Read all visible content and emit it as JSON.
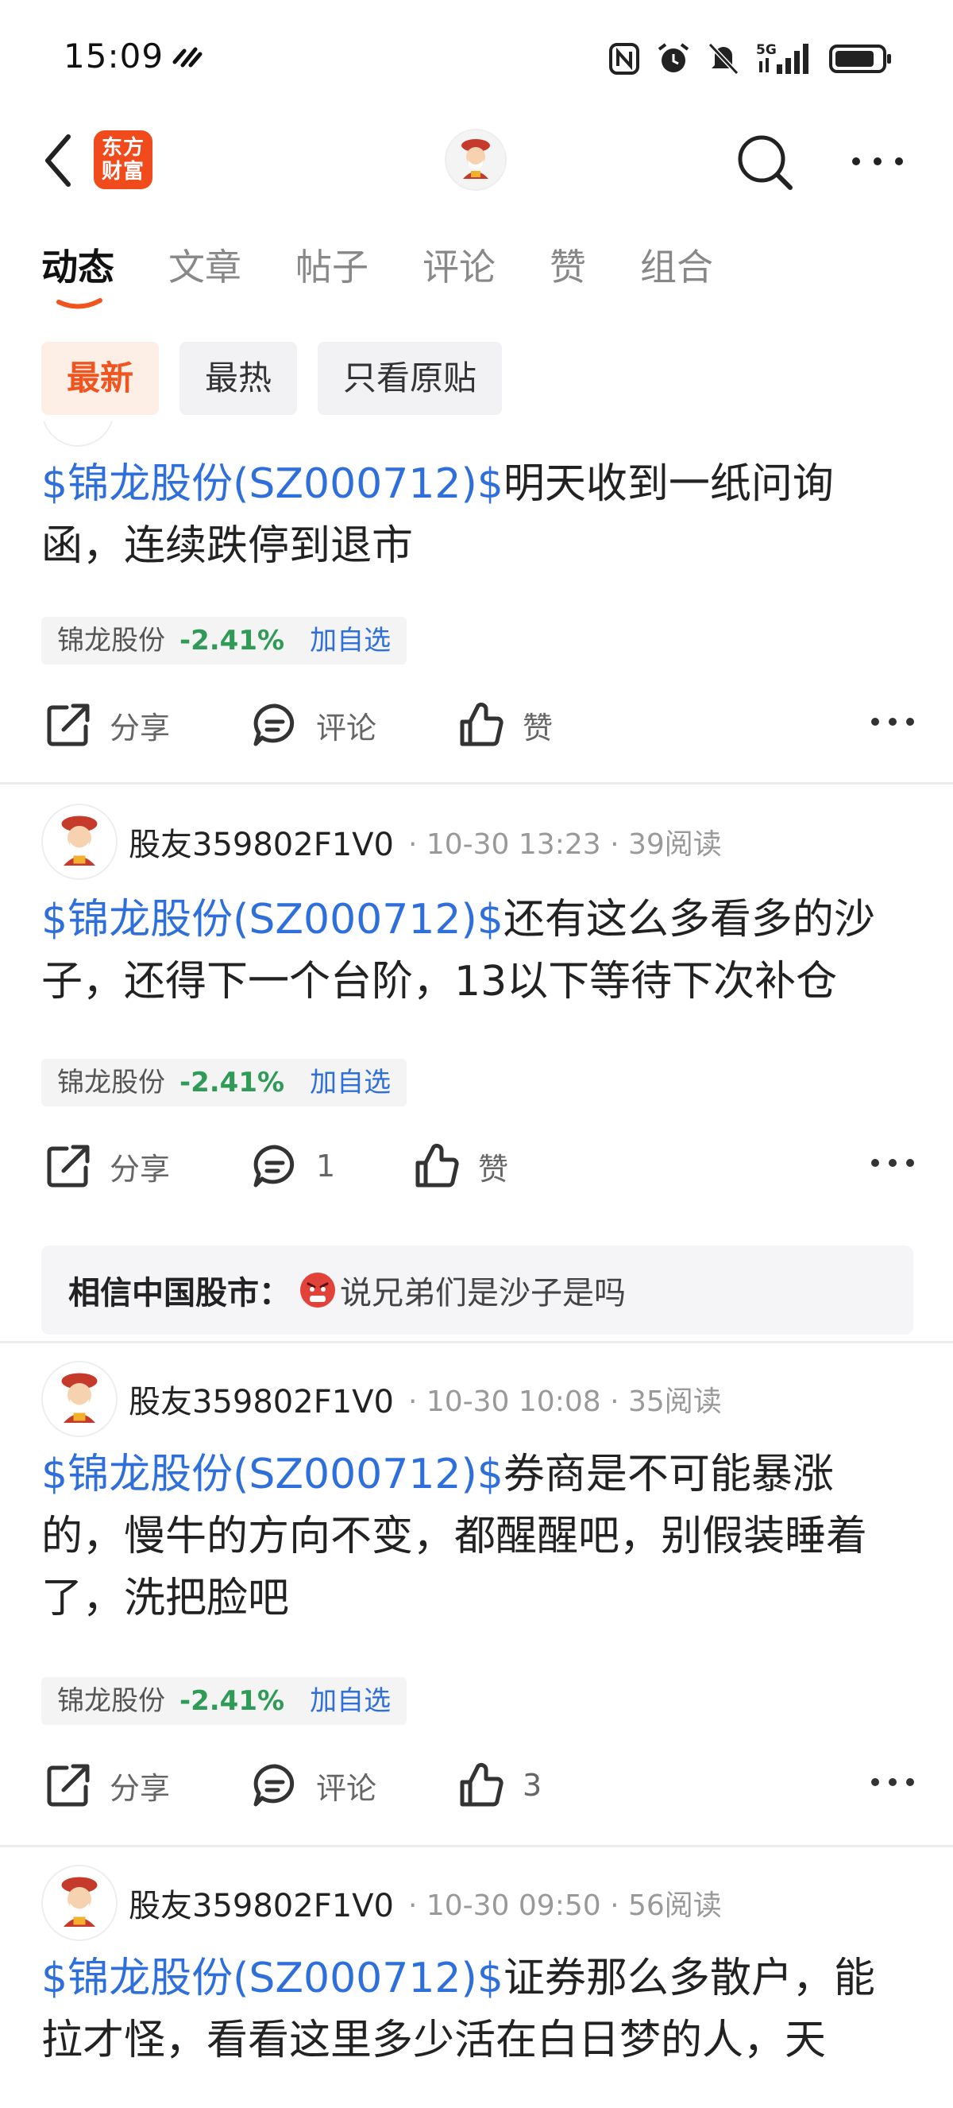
{
  "status_bar": {
    "time": "15:09",
    "network": "5G"
  },
  "header": {
    "logo_line1": "东方",
    "logo_line2": "财富"
  },
  "tabs": [
    {
      "label": "动态",
      "active": true
    },
    {
      "label": "文章",
      "active": false
    },
    {
      "label": "帖子",
      "active": false
    },
    {
      "label": "评论",
      "active": false
    },
    {
      "label": "赞",
      "active": false
    },
    {
      "label": "组合",
      "active": false
    }
  ],
  "filters": [
    {
      "label": "最新",
      "active": true
    },
    {
      "label": "最热",
      "active": false
    },
    {
      "label": "只看原贴",
      "active": false
    }
  ],
  "posts": [
    {
      "ticker": "$锦龙股份(SZ000712)$",
      "text": "明天收到一纸问询函，连续跌停到退市",
      "stock": {
        "name": "锦龙股份",
        "change": "-2.41%",
        "add_label": "加自选"
      },
      "actions": {
        "share": "分享",
        "comment": "评论",
        "like": "赞"
      }
    },
    {
      "author": "股友359802F1V0",
      "meta": "· 10-30 13:23 · 39阅读",
      "ticker": "$锦龙股份(SZ000712)$",
      "text": "还有这么多看多的沙子，还得下一个台阶，13以下等待下次补仓",
      "stock": {
        "name": "锦龙股份",
        "change": "-2.41%",
        "add_label": "加自选"
      },
      "actions": {
        "share": "分享",
        "comment": "1",
        "like": "赞"
      },
      "reply": {
        "user": "相信中国股市：",
        "text": "说兄弟们是沙子是吗"
      }
    },
    {
      "author": "股友359802F1V0",
      "meta": "· 10-30 10:08 · 35阅读",
      "ticker": "$锦龙股份(SZ000712)$",
      "text": "券商是不可能暴涨的，慢牛的方向不变，都醒醒吧，别假装睡着了，洗把脸吧",
      "stock": {
        "name": "锦龙股份",
        "change": "-2.41%",
        "add_label": "加自选"
      },
      "actions": {
        "share": "分享",
        "comment": "评论",
        "like": "3"
      }
    },
    {
      "author": "股友359802F1V0",
      "meta": "· 10-30 09:50 · 56阅读",
      "ticker": "$锦龙股份(SZ000712)$",
      "text": "证券那么多散户，能拉才怪，看看这里多少活在白日梦的人，天"
    }
  ],
  "colors": {
    "accent": "#f0541f",
    "link": "#2f6fdb",
    "down": "#2f9b57"
  }
}
